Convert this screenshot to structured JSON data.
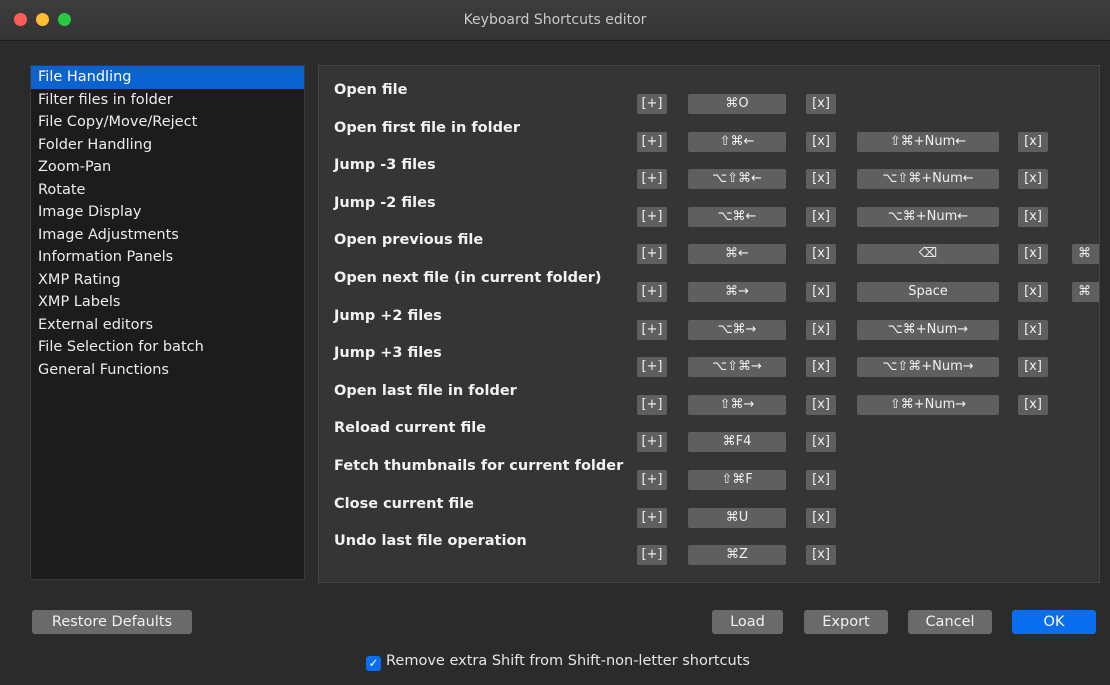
{
  "window": {
    "title": "Keyboard Shortcuts editor"
  },
  "sidebar": {
    "items": [
      {
        "label": "File Handling"
      },
      {
        "label": "Filter files in folder"
      },
      {
        "label": "File Copy/Move/Reject"
      },
      {
        "label": "Folder Handling"
      },
      {
        "label": "Zoom-Pan"
      },
      {
        "label": "Rotate"
      },
      {
        "label": "Image Display"
      },
      {
        "label": "Image Adjustments"
      },
      {
        "label": "Information Panels"
      },
      {
        "label": "XMP Rating"
      },
      {
        "label": "XMP Labels"
      },
      {
        "label": "External editors"
      },
      {
        "label": "File Selection for batch"
      },
      {
        "label": "General Functions"
      }
    ],
    "selected": "File Handling"
  },
  "buttons": {
    "add": "[+]",
    "remove": "[x]"
  },
  "shortcuts": [
    {
      "label": "Open file",
      "key1": "⌘O"
    },
    {
      "label": "Open first file in folder",
      "key1": "⇧⌘←",
      "key2": "⇧⌘+Num←"
    },
    {
      "label": "Jump -3 files",
      "key1": "⌥⇧⌘←",
      "key2": "⌥⇧⌘+Num←"
    },
    {
      "label": "Jump -2 files",
      "key1": "⌥⌘←",
      "key2": "⌥⌘+Num←"
    },
    {
      "label": "Open previous file",
      "key1": "⌘←",
      "key2": "⌫",
      "key3": "⌘"
    },
    {
      "label": "Open next file (in current folder)",
      "key1": "⌘→",
      "key2": "Space",
      "key3": "⌘"
    },
    {
      "label": "Jump +2 files",
      "key1": "⌥⌘→",
      "key2": "⌥⌘+Num→"
    },
    {
      "label": "Jump +3 files",
      "key1": "⌥⇧⌘→",
      "key2": "⌥⇧⌘+Num→"
    },
    {
      "label": "Open last file in folder",
      "key1": "⇧⌘→",
      "key2": "⇧⌘+Num→"
    },
    {
      "label": "Reload current file",
      "key1": "⌘F4"
    },
    {
      "label": "Fetch thumbnails for current folder",
      "key1": "⇧⌘F"
    },
    {
      "label": "Close current file",
      "key1": "⌘U"
    },
    {
      "label": "Undo last file operation",
      "key1": "⌘Z"
    }
  ],
  "footer": {
    "restore_defaults": "Restore Defaults",
    "load": "Load",
    "export": "Export",
    "cancel": "Cancel",
    "ok": "OK",
    "checkbox_label": "Remove extra Shift from Shift-non-letter shortcuts",
    "checkbox_checked": true
  },
  "colors": {
    "accent": "#0a6ef0",
    "selection": "#0a63d1",
    "background": "#2b2b2b",
    "key_button": "#5f5f5f"
  }
}
